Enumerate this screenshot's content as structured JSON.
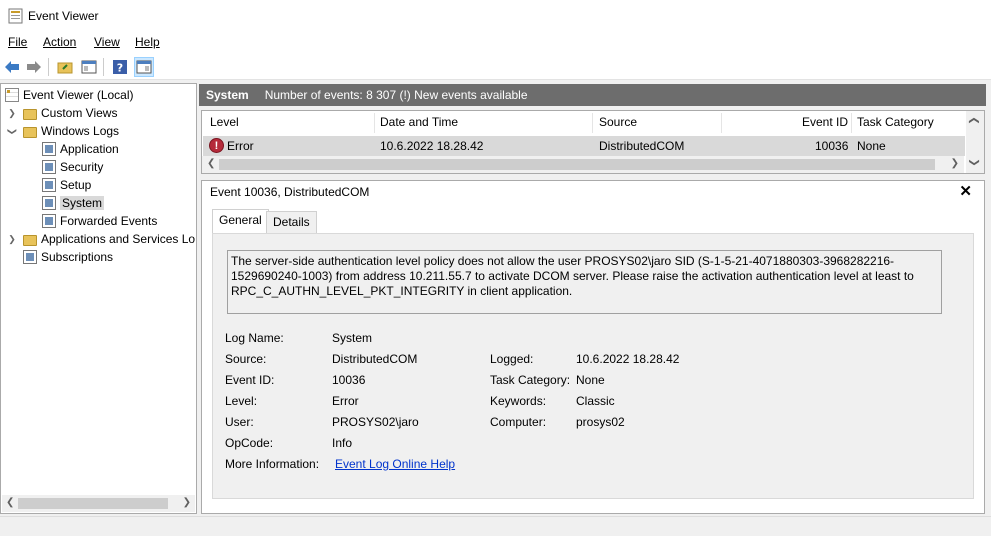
{
  "window": {
    "title": "Event Viewer"
  },
  "menu": [
    "File",
    "Action",
    "View",
    "Help"
  ],
  "toolbar": {
    "buttons": [
      "back-arrow-icon",
      "forward-arrow-icon",
      "open-folder-icon",
      "show-hide-pane-icon",
      "help-icon",
      "action-pane-icon"
    ]
  },
  "tree": {
    "root": "Event Viewer (Local)",
    "custom_views": "Custom Views",
    "windows_logs": "Windows Logs",
    "application": "Application",
    "security": "Security",
    "setup": "Setup",
    "system": "System",
    "forwarded_events": "Forwarded Events",
    "apps_services": "Applications and Services Lo",
    "subscriptions": "Subscriptions"
  },
  "header": {
    "log_name": "System",
    "count_text": "Number of events: 8 307 (!) New events available"
  },
  "events_table": {
    "columns": [
      "Level",
      "Date and Time",
      "Source",
      "Event ID",
      "Task Category"
    ],
    "rows": [
      {
        "level": "Error",
        "date_time": "10.6.2022 18.28.42",
        "source": "DistributedCOM",
        "event_id": "10036",
        "task_category": "None"
      }
    ]
  },
  "detail": {
    "title": "Event 10036, DistributedCOM",
    "tabs": [
      "General",
      "Details"
    ],
    "description": "The server-side authentication level policy does not allow the user PROSYS02\\jaro SID (S-1-5-21-4071880303-3968282216-1529690240-1003) from address 10.211.55.7 to activate DCOM server. Please raise the activation authentication level at least to RPC_C_AUTHN_LEVEL_PKT_INTEGRITY in client application.",
    "labels": {
      "log_name": "Log Name:",
      "source": "Source:",
      "event_id": "Event ID:",
      "level": "Level:",
      "user": "User:",
      "opcode": "OpCode:",
      "more_info": "More Information:",
      "logged": "Logged:",
      "task_category": "Task Category:",
      "keywords": "Keywords:",
      "computer": "Computer:"
    },
    "values": {
      "log_name": "System",
      "source": "DistributedCOM",
      "event_id": "10036",
      "level": "Error",
      "user": "PROSYS02\\jaro",
      "opcode": "Info",
      "more_info": "Event Log Online Help",
      "logged": "10.6.2022 18.28.42",
      "task_category": "None",
      "keywords": "Classic",
      "computer": "prosys02"
    }
  }
}
